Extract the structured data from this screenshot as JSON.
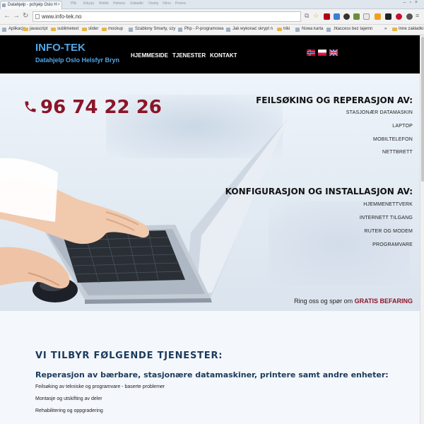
{
  "browser": {
    "tab_title": "Datahjelp - pchjelp Oslo H",
    "menu_ghost": [
      "Plik",
      "Edycja",
      "Widok",
      "Historia",
      "Zakładki",
      "Osoby",
      "Okno",
      "Pomoc"
    ],
    "address": "www.info-tek.no",
    "bookmarks": [
      {
        "label": "Aplikacje",
        "icon": "apps-icon"
      },
      {
        "label": "javascript",
        "icon": "folder-icon"
      },
      {
        "label": "sublimetext",
        "icon": "folder-icon"
      },
      {
        "label": "slider",
        "icon": "folder-icon"
      },
      {
        "label": "mockup",
        "icon": "folder-icon"
      },
      {
        "label": "Szablony Smarty, szy",
        "icon": "page-icon"
      },
      {
        "label": "Php - P-programowa",
        "icon": "page-icon"
      },
      {
        "label": "Jak wykonać skrypt n",
        "icon": "page-icon"
      },
      {
        "label": "triki",
        "icon": "folder-icon"
      },
      {
        "label": "Nowa karta",
        "icon": "page-icon"
      },
      {
        "label": ".htaccess bez tajemn",
        "icon": "page-icon"
      },
      {
        "label": "Inne zakładki",
        "icon": "folder-icon"
      }
    ]
  },
  "site": {
    "logo_title": "INFO-TEK",
    "logo_sub": "Datahjelp Oslo Helsfyr Bryn",
    "nav": [
      "HJEMMESIDE",
      "TJENESTER",
      "KONTAKT"
    ],
    "flags": [
      "norway-flag-icon",
      "poland-flag-icon",
      "uk-flag-icon"
    ]
  },
  "hero": {
    "phone": "96 74 22 26",
    "section1_title": "FEILSØKING OG REPERASJON AV:",
    "section1_items": [
      "STASJONÆR DATAMASKIN",
      "LAPTOP",
      "MOBILTELEFON",
      "NETTBRETT"
    ],
    "section2_title": "KONFIGURASJON OG INSTALLASJON AV:",
    "section2_items": [
      "HJEMMENETTVERK",
      "INTERNETT TILGANG",
      "RUTER OG MODEM",
      "PROGRAMVARE"
    ],
    "cta_text": "Ring oss og spør om",
    "cta_bold": "GRATIS BEFARING"
  },
  "services": {
    "title": "VI TILBYR FØLGENDE TJENESTER:",
    "subtitle": "Reperasjon av bærbare, stasjonære datamaskiner, printere samt andre enheter:",
    "items": [
      "Feilsøking av tekniske og programvare - baserte problemer",
      "Montasje og utskifting av deler",
      "Rehabilitering og oppgradering"
    ]
  },
  "colors": {
    "brand_blue": "#4fa6e6",
    "accent_red": "#8c1428",
    "heading_navy": "#1b3a5c"
  }
}
